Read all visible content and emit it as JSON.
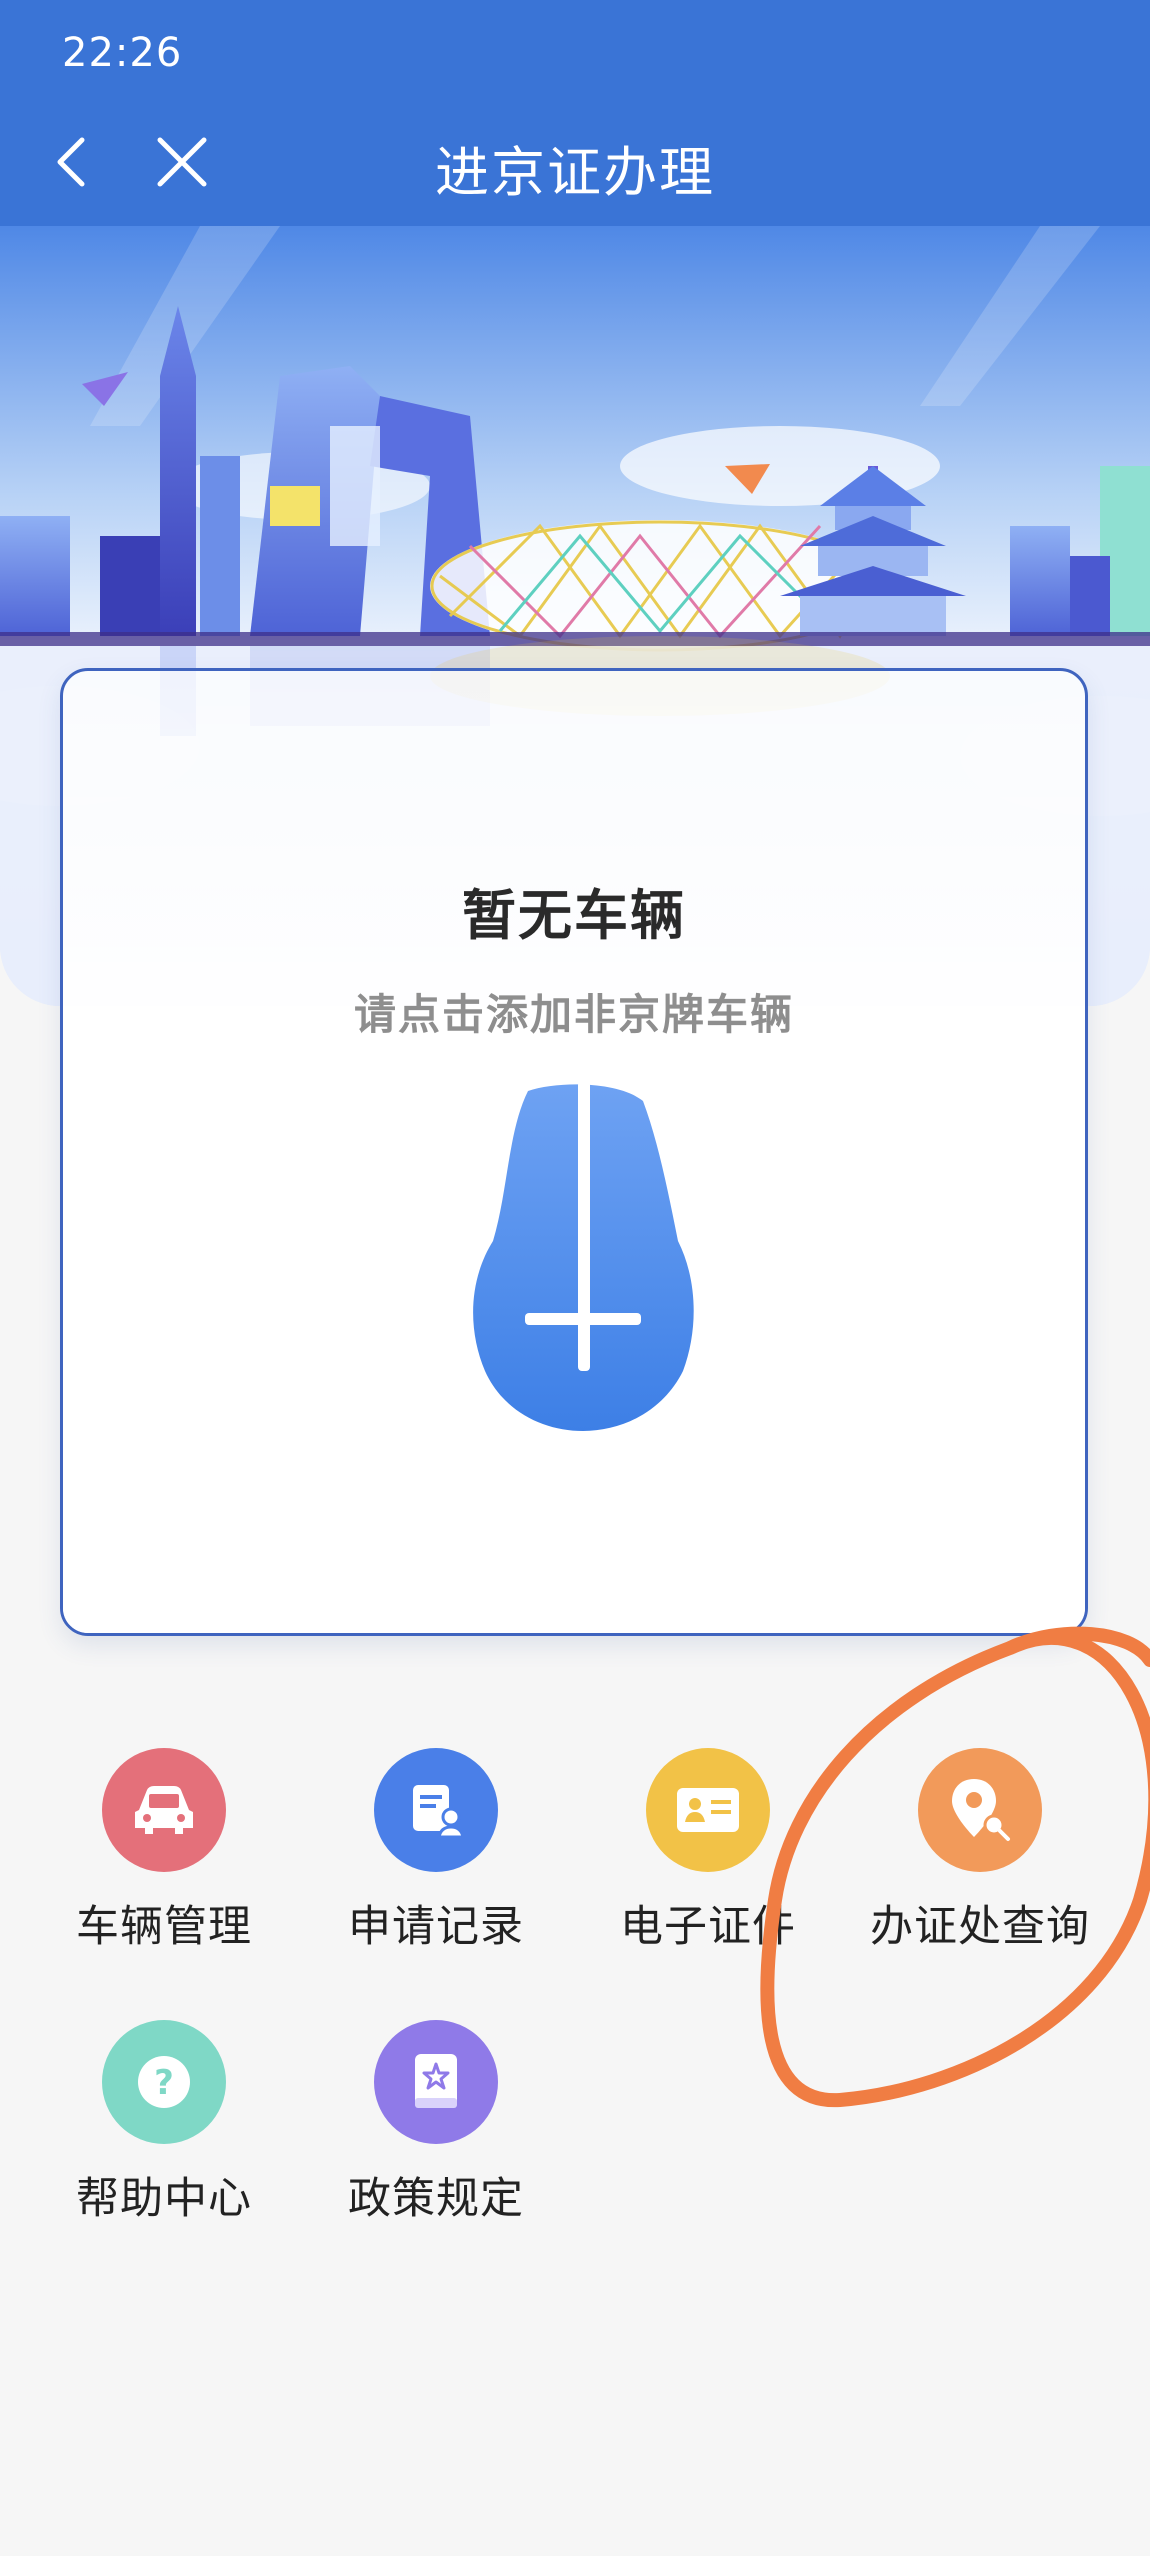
{
  "status_bar": {
    "time": "22:26"
  },
  "header": {
    "title": "进京证办理"
  },
  "card": {
    "title": "暂无车辆",
    "subtitle": "请点击添加非京牌车辆"
  },
  "menu": [
    {
      "label": "车辆管理",
      "icon": "car-icon",
      "color": "#e4707a"
    },
    {
      "label": "申请记录",
      "icon": "document-person-icon",
      "color": "#4a7fe8"
    },
    {
      "label": "电子证件",
      "icon": "id-card-icon",
      "color": "#f2c247"
    },
    {
      "label": "办证处查询",
      "icon": "location-search-icon",
      "color": "#f29a5a"
    },
    {
      "label": "帮助中心",
      "icon": "question-icon",
      "color": "#7fd8c6"
    },
    {
      "label": "政策规定",
      "icon": "policy-book-icon",
      "color": "#8f7ae8"
    }
  ],
  "colors": {
    "primary": "#3a74d6",
    "annotation": "#f07d43"
  }
}
